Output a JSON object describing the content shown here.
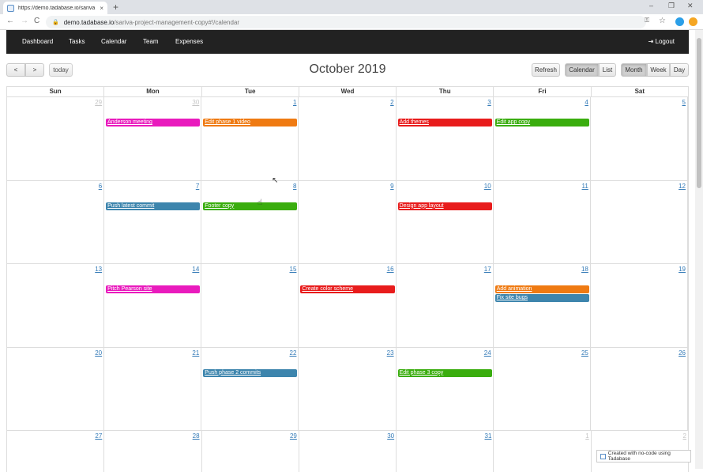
{
  "browser": {
    "tab_title": "https://demo.tadabase.io/sariva",
    "tab_close": "×",
    "new_tab": "+",
    "url_host": "demo.tadabase.io",
    "url_path": "/sariva-project-management-copy#!/calendar",
    "nav": {
      "back": "←",
      "forward": "→",
      "reload": "C"
    },
    "window": {
      "minimize": "–",
      "restore": "❐",
      "close": "✕"
    }
  },
  "appnav": {
    "items": [
      "Dashboard",
      "Tasks",
      "Calendar",
      "Team",
      "Expenses"
    ],
    "logout": "⇥ Logout"
  },
  "toolbar": {
    "prev": "<",
    "next": ">",
    "today": "today",
    "title": "October 2019",
    "refresh": "Refresh",
    "view_calendar": "Calendar",
    "view_list": "List",
    "range_month": "Month",
    "range_week": "Week",
    "range_day": "Day"
  },
  "calendar": {
    "weekdays": [
      "Sun",
      "Mon",
      "Tue",
      "Wed",
      "Thu",
      "Fri",
      "Sat"
    ],
    "weeks": [
      {
        "days": [
          "29",
          "30",
          "1",
          "2",
          "3",
          "4",
          "5"
        ],
        "other": [
          true,
          true,
          false,
          false,
          false,
          false,
          false
        ]
      },
      {
        "days": [
          "6",
          "7",
          "8",
          "9",
          "10",
          "11",
          "12"
        ],
        "other": [
          false,
          false,
          false,
          false,
          false,
          false,
          false
        ]
      },
      {
        "days": [
          "13",
          "14",
          "15",
          "16",
          "17",
          "18",
          "19"
        ],
        "other": [
          false,
          false,
          false,
          false,
          false,
          false,
          false
        ]
      },
      {
        "days": [
          "20",
          "21",
          "22",
          "23",
          "24",
          "25",
          "26"
        ],
        "other": [
          false,
          false,
          false,
          false,
          false,
          false,
          false
        ]
      },
      {
        "days": [
          "27",
          "28",
          "29",
          "30",
          "31",
          "1",
          "2"
        ],
        "other": [
          false,
          false,
          false,
          false,
          false,
          true,
          true
        ]
      }
    ],
    "events": [
      {
        "title": "Anderson meeting",
        "week": 0,
        "day": 1,
        "row": 0,
        "color": "#e91bbd"
      },
      {
        "title": "Edit phase 1 video",
        "week": 0,
        "day": 2,
        "row": 0,
        "color": "#ef7a12"
      },
      {
        "title": "Add themes",
        "week": 0,
        "day": 4,
        "row": 0,
        "color": "#e81c1c"
      },
      {
        "title": "Edit app copy",
        "week": 0,
        "day": 5,
        "row": 0,
        "color": "#3aad0e"
      },
      {
        "title": "Push latest commit",
        "week": 1,
        "day": 1,
        "row": 0,
        "color": "#3d85ad"
      },
      {
        "title": "Footer copy",
        "week": 1,
        "day": 2,
        "row": 0,
        "color": "#3aad0e"
      },
      {
        "title": "Design app layout",
        "week": 1,
        "day": 4,
        "row": 0,
        "color": "#e81c1c"
      },
      {
        "title": "Pitch Pearson site",
        "week": 2,
        "day": 1,
        "row": 0,
        "color": "#e91bbd"
      },
      {
        "title": "Create color scheme",
        "week": 2,
        "day": 3,
        "row": 0,
        "color": "#e81c1c"
      },
      {
        "title": "Add animation",
        "week": 2,
        "day": 5,
        "row": 0,
        "color": "#ef7a12"
      },
      {
        "title": "Fix site bugs",
        "week": 2,
        "day": 5,
        "row": 1,
        "color": "#3d85ad"
      },
      {
        "title": "Push phase 2 commits",
        "week": 3,
        "day": 2,
        "row": 0,
        "color": "#3d85ad"
      },
      {
        "title": "Edit phase 3 copy",
        "week": 3,
        "day": 4,
        "row": 0,
        "color": "#3aad0e"
      }
    ]
  },
  "badge": {
    "text": "Created with no-code using Tadabase"
  }
}
